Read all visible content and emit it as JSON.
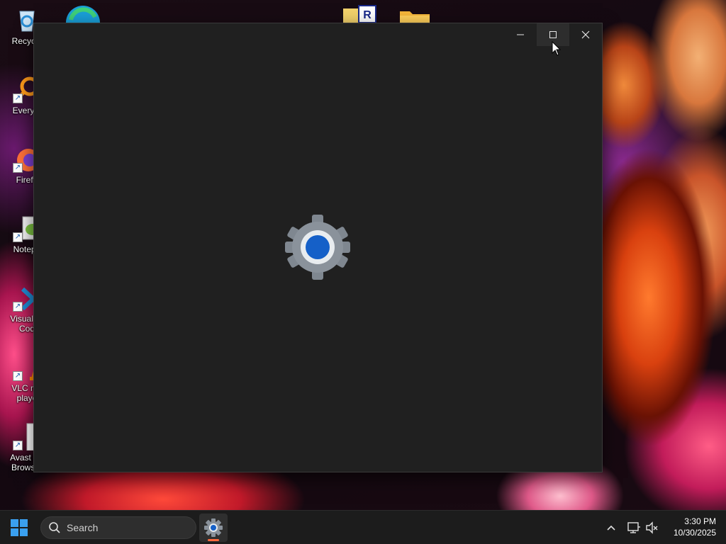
{
  "desktop": {
    "icons": [
      {
        "label": "Recycle"
      },
      {
        "label": "Everyth"
      },
      {
        "label": "Firefo"
      },
      {
        "label": "Notepa"
      },
      {
        "label": "Visual St\nCod"
      },
      {
        "label": "VLC me\nplaye"
      },
      {
        "label": "Avast Se\nBrowser"
      }
    ]
  },
  "window": {
    "app": "Settings",
    "state": "loading-splash",
    "splash_icon": "settings-gear-icon",
    "caption_buttons": [
      "minimize-icon",
      "maximize-icon",
      "close-icon"
    ]
  },
  "taskbar": {
    "search_placeholder": "Search",
    "pinned_apps": [
      "settings-icon"
    ],
    "tray_icons": [
      "chevron-up-icon",
      "network-icon",
      "volume-muted-icon"
    ],
    "time": "3:30 PM",
    "date": "10/30/2025",
    "accent_underline": "#ff6a3d"
  },
  "colors": {
    "window_bg": "#202020",
    "taskbar_bg": "#1c1c1c",
    "start_blue": "#0078d4",
    "gear_gray": "#7f8790",
    "gear_center_blue": "#1560c8"
  }
}
